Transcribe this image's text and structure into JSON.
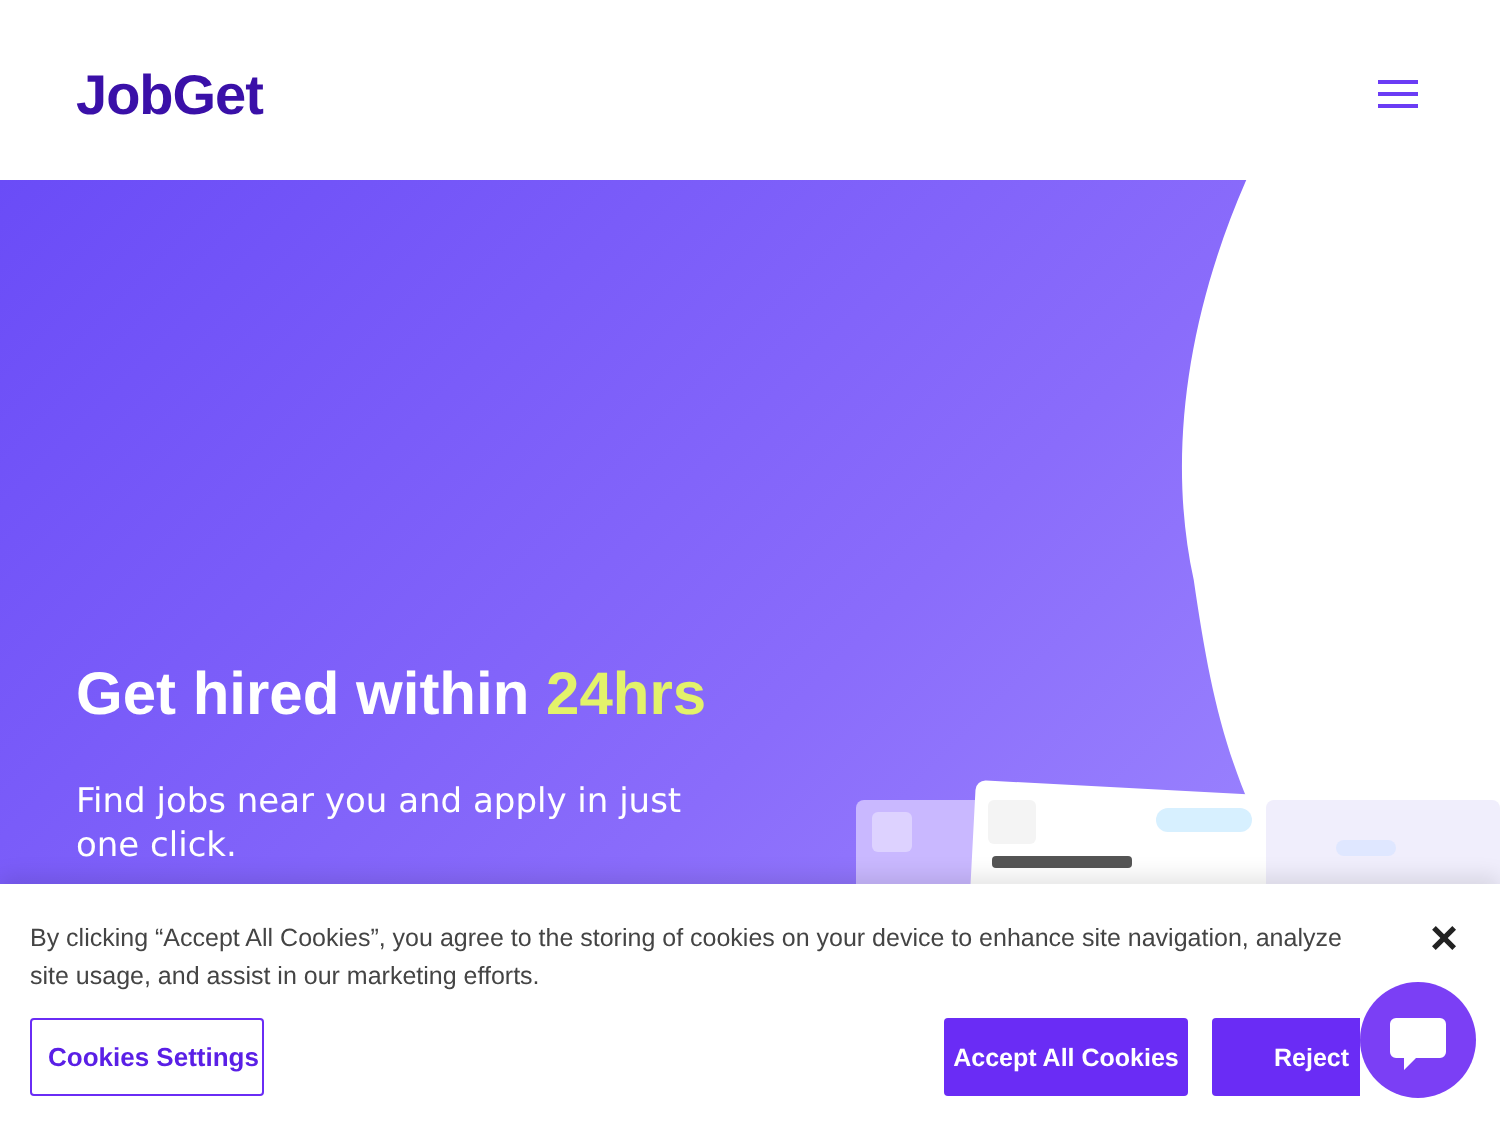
{
  "header": {
    "logo": "JobGet"
  },
  "hero": {
    "heading": "Get hired within",
    "heading_highlight": "24hrs",
    "subtitle": "Find jobs near you and apply in just one click."
  },
  "cookie_banner": {
    "text": "By clicking “Accept All Cookies”, you agree to the storing of cookies on your device to enhance site navigation, analyze site usage, and assist in our marketing efforts.",
    "close": "×",
    "buttons": [
      {
        "label": "Cookies Settings",
        "kind": "outline"
      },
      {
        "label": "Accept All Cookies",
        "kind": "primary"
      },
      {
        "label": "Reject",
        "kind": "primary"
      }
    ]
  }
}
